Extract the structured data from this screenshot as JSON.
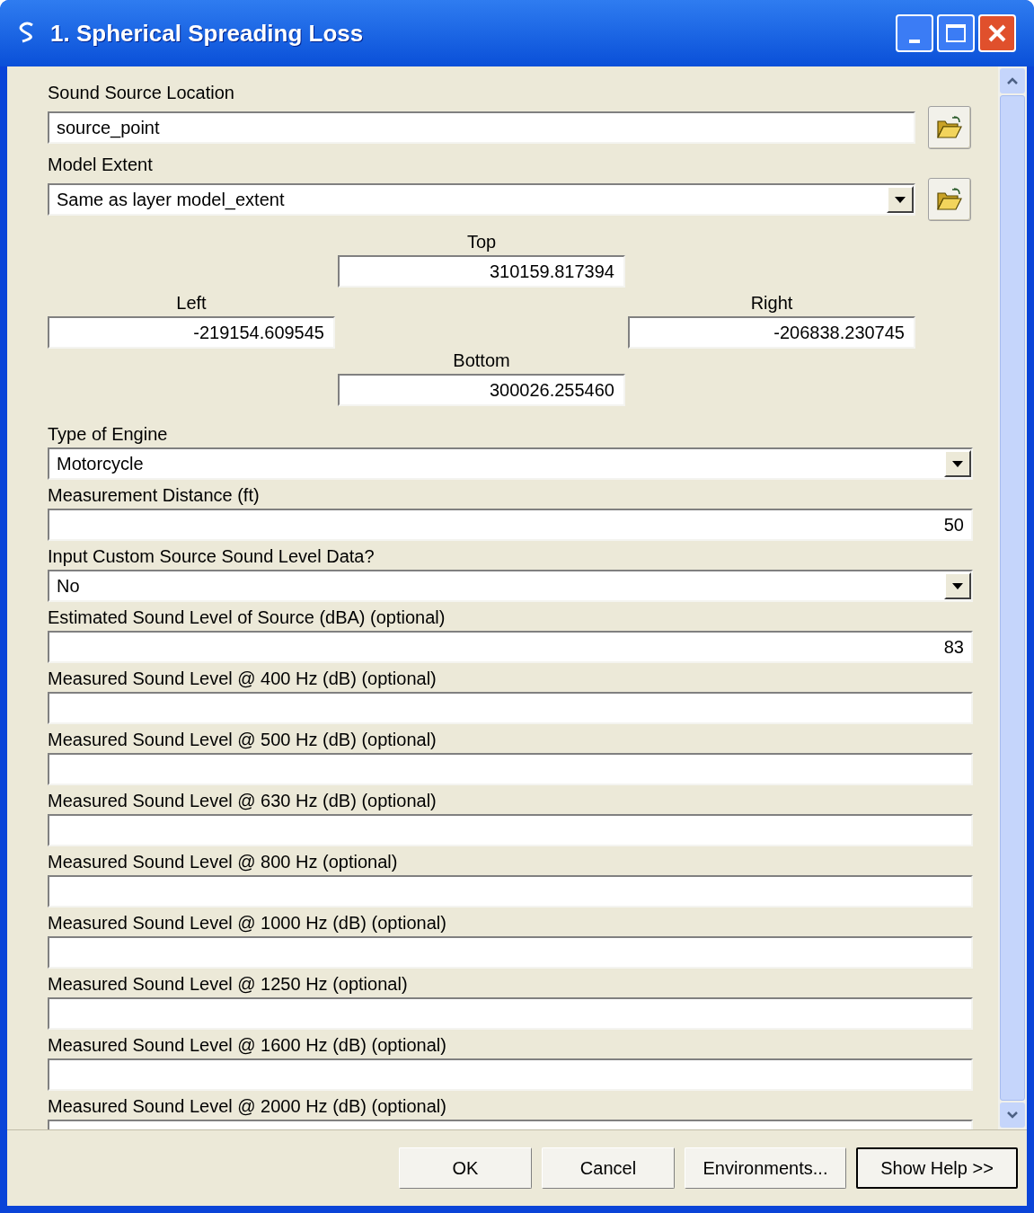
{
  "window": {
    "title": "1. Spherical Spreading Loss"
  },
  "params": [
    {
      "kind": "text",
      "label": "Sound Source Location",
      "value": "source_point",
      "browse": true
    },
    {
      "kind": "dropdown",
      "label": "Model Extent",
      "value": "Same as layer model_extent",
      "browse": true
    },
    {
      "kind": "extent",
      "top": {
        "label": "Top",
        "value": "310159.817394"
      },
      "left": {
        "label": "Left",
        "value": "-219154.609545"
      },
      "right": {
        "label": "Right",
        "value": "-206838.230745"
      },
      "bottom": {
        "label": "Bottom",
        "value": "300026.255460"
      }
    },
    {
      "kind": "dropdown",
      "label": "Type of Engine",
      "value": "Motorcycle"
    },
    {
      "kind": "number",
      "label": "Measurement Distance (ft)",
      "value": "50"
    },
    {
      "kind": "dropdown",
      "label": "Input Custom Source Sound Level Data?",
      "value": "No"
    },
    {
      "kind": "number",
      "label": "Estimated Sound Level of Source (dBA) (optional)",
      "value": "83"
    },
    {
      "kind": "number",
      "label": "Measured Sound Level @ 400 Hz (dB) (optional)"
    },
    {
      "kind": "number",
      "label": "Measured Sound Level @ 500 Hz (dB) (optional)"
    },
    {
      "kind": "number",
      "label": "Measured Sound Level @ 630 Hz (dB) (optional)"
    },
    {
      "kind": "number",
      "label": "Measured Sound Level @ 800 Hz (optional)"
    },
    {
      "kind": "number",
      "label": "Measured Sound Level @ 1000 Hz (dB) (optional)"
    },
    {
      "kind": "number",
      "label": "Measured Sound Level @ 1250 Hz (optional)"
    },
    {
      "kind": "number",
      "label": "Measured Sound Level @ 1600 Hz (dB) (optional)"
    },
    {
      "kind": "number",
      "label": "Measured Sound Level @ 2000 Hz (dB) (optional)"
    }
  ],
  "buttons": [
    {
      "label": "OK",
      "default": false
    },
    {
      "label": "Cancel",
      "default": false
    },
    {
      "label": "Environments...",
      "default": false
    },
    {
      "label": "Show Help >>",
      "default": true
    }
  ]
}
